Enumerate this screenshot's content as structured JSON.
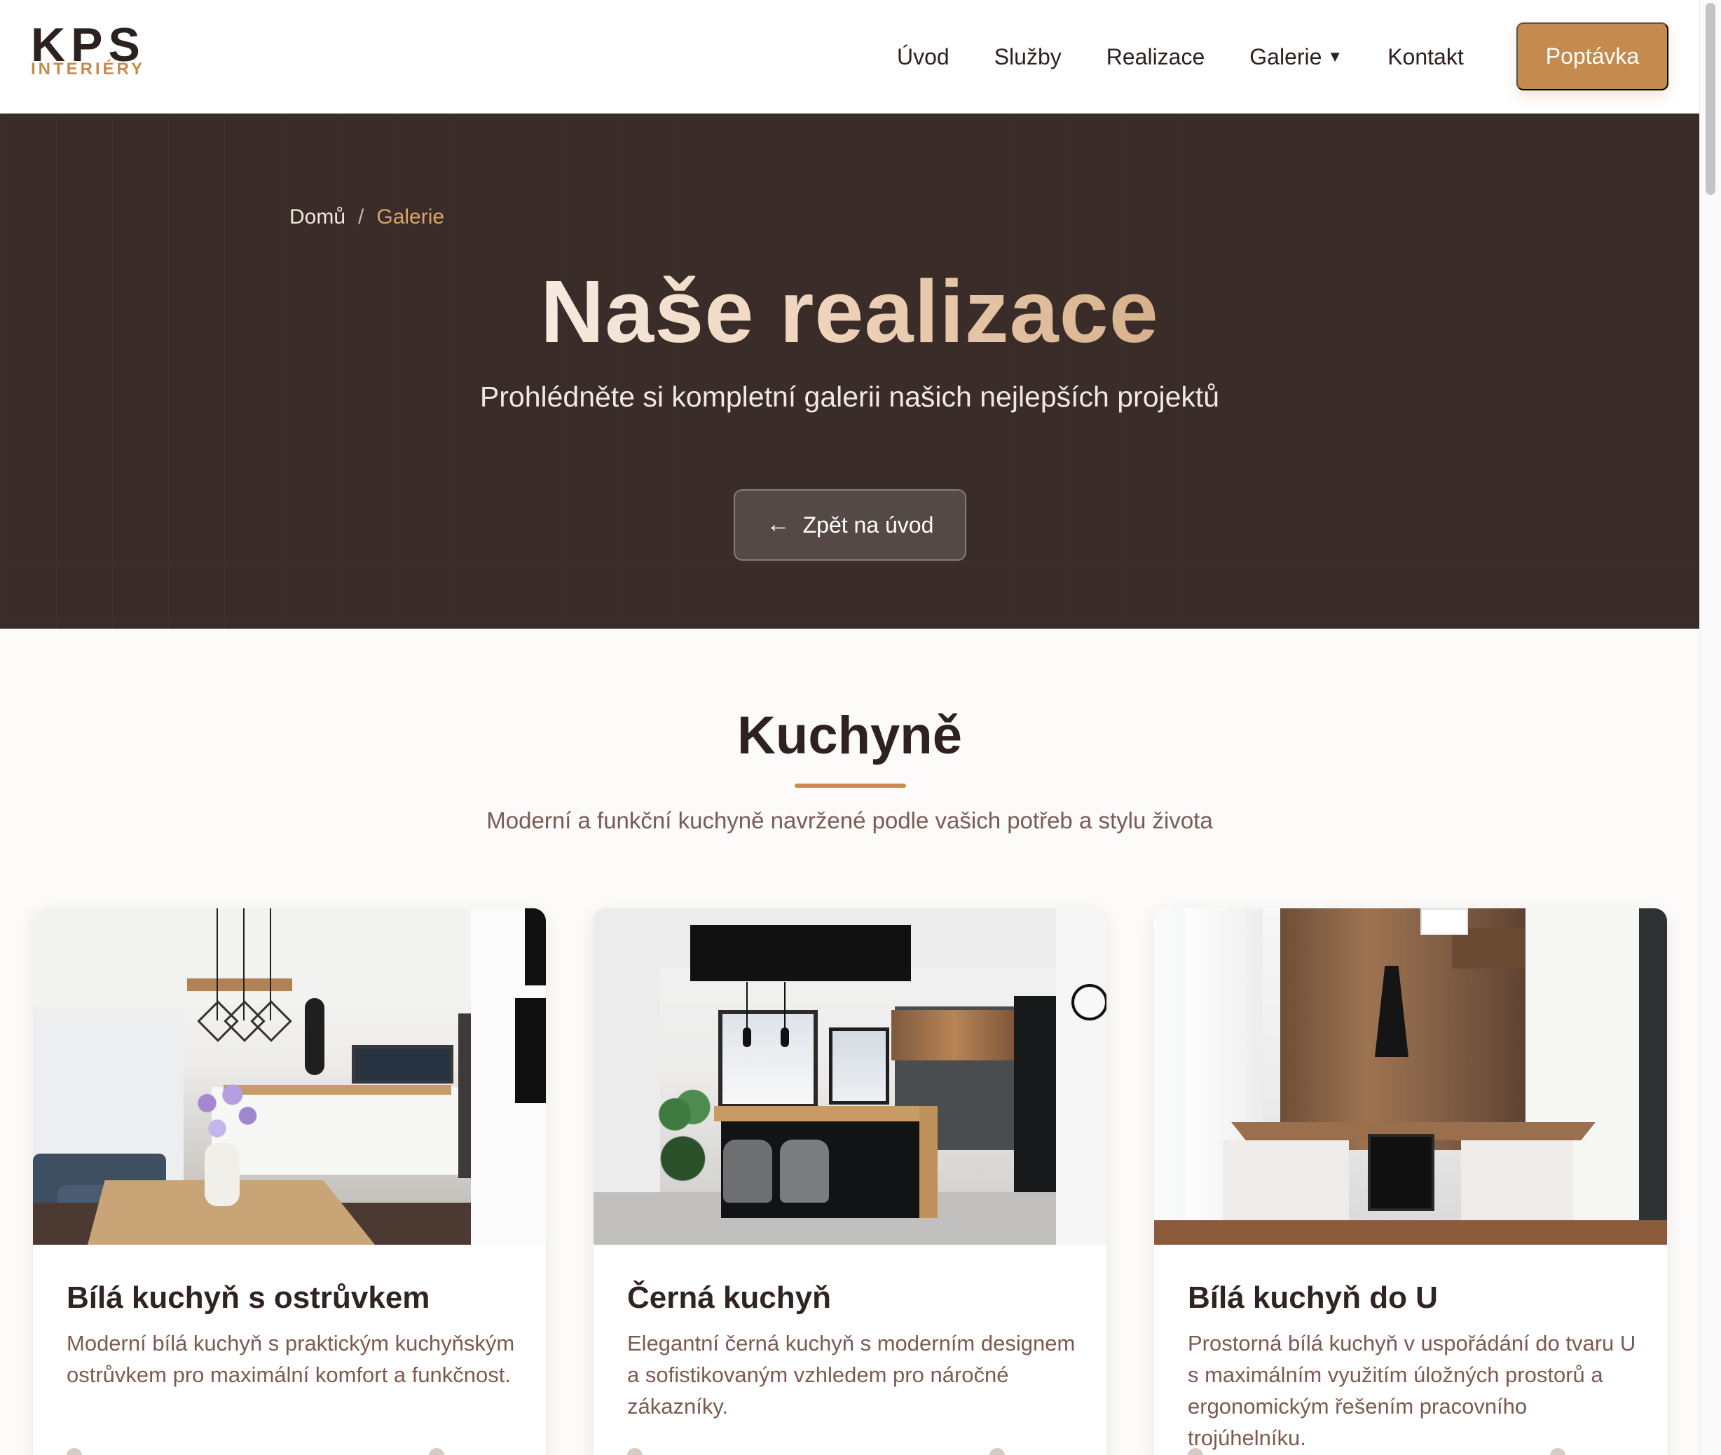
{
  "brand": {
    "logo_top": "KPS",
    "logo_bottom": "INTERIÉRY"
  },
  "nav": {
    "items": [
      "Úvod",
      "Služby",
      "Realizace",
      "Galerie",
      "Kontakt"
    ],
    "dropdown_indicator": "▼",
    "cta": "Poptávka"
  },
  "hero": {
    "breadcrumb": {
      "home": "Domů",
      "separator": "/",
      "current": "Galerie"
    },
    "title": "Naše realizace",
    "subtitle": "Prohlédněte si kompletní galerii našich nejlepších projektů",
    "back_button": "Zpět na úvod",
    "back_icon": "←"
  },
  "section": {
    "title": "Kuchyně",
    "subtitle": "Moderní a funkční kuchyně navržené podle vašich potřeb a stylu života"
  },
  "cards": [
    {
      "title": "Bílá kuchyň s ostrůvkem",
      "description": "Moderní bílá kuchyň s praktickým kuchyňským ostrůvkem pro maximální komfort a funkčnost."
    },
    {
      "title": "Černá kuchyň",
      "description": "Elegantní černá kuchyň s moderním designem a sofistikovaným vzhledem pro náročné zákazníky."
    },
    {
      "title": "Bílá kuchyň do U",
      "description": "Prostorná bílá kuchyň v uspořádání do tvaru U s maximálním využitím úložných prostorů a ergonomickým řešením pracovního trojúhelníku."
    }
  ],
  "colors": {
    "accent": "#c58a4d",
    "hero_background": "#3a2c28",
    "text_dark": "#2f2421",
    "text_muted": "#7d5a51"
  },
  "icons": {
    "dropdown": "chevron-down-icon",
    "back": "arrow-left-icon"
  }
}
